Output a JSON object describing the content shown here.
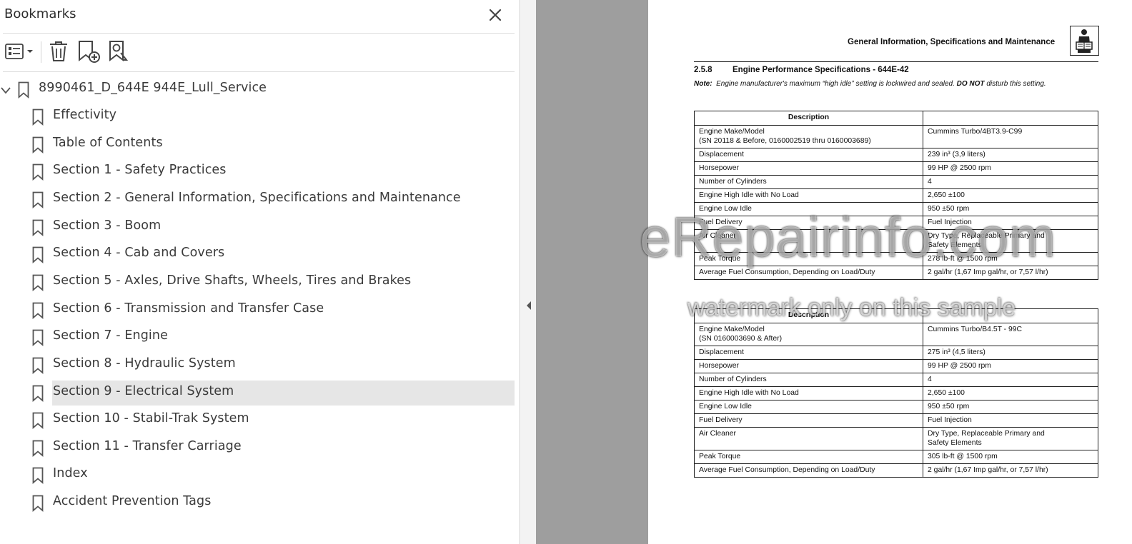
{
  "bookmarks_panel": {
    "title": "Bookmarks",
    "toolbar": {
      "options_button": "list-options-icon",
      "delete_button": "trash-icon",
      "new_bookmark_button": "bookmark-add-icon",
      "find_bookmark_button": "bookmark-search-icon"
    },
    "root": {
      "label": "8990461_D_644E 944E_Lull_Service",
      "expanded": true
    },
    "items": [
      {
        "label": "Effectivity"
      },
      {
        "label": "Table of Contents"
      },
      {
        "label": "Section 1 - Safety Practices"
      },
      {
        "label": "Section 2 - General Information, Specifications and Maintenance"
      },
      {
        "label": "Section 3 - Boom"
      },
      {
        "label": "Section 4 - Cab and Covers"
      },
      {
        "label": "Section 5 - Axles, Drive Shafts, Wheels, Tires and Brakes"
      },
      {
        "label": "Section 6 - Transmission and Transfer Case"
      },
      {
        "label": "Section 7 - Engine"
      },
      {
        "label": "Section 8 - Hydraulic System"
      },
      {
        "label": "Section 9 - Electrical System",
        "selected": true
      },
      {
        "label": "Section 10 - Stabil-Trak System"
      },
      {
        "label": "Section 11 - Transfer Carriage"
      },
      {
        "label": "Index"
      },
      {
        "label": "Accident Prevention Tags"
      }
    ]
  },
  "document": {
    "header": "General Information, Specifications and Maintenance",
    "section_number": "2.5.8",
    "section_title": "Engine Performance Specifications - 644E-42",
    "note_label": "Note:",
    "note_text_1": "Engine manufacturer's maximum “high idle” setting is lockwired and sealed.",
    "note_emph": "DO NOT",
    "note_text_2": "disturb this setting.",
    "table_1": {
      "header": [
        "Description",
        ""
      ],
      "rows": [
        [
          "Engine Make/Model\n(SN 20118 & Before, 0160002519 thru 0160003689)",
          "Cummins Turbo/4BT3.9-C99"
        ],
        [
          "Displacement",
          "239 in³ (3,9 liters)"
        ],
        [
          "Horsepower",
          "99 HP @ 2500 rpm"
        ],
        [
          "Number of Cylinders",
          "4"
        ],
        [
          "Engine High Idle with No Load",
          "2,650 ±100"
        ],
        [
          "Engine Low Idle",
          "950 ±50 rpm"
        ],
        [
          "Fuel Delivery",
          "Fuel Injection"
        ],
        [
          "Air Cleaner",
          "Dry Type, Replaceable Primary and\nSafety Elements"
        ],
        [
          "Peak Torque",
          "278 lb-ft @ 1500 rpm"
        ],
        [
          "Average Fuel Consumption, Depending on Load/Duty",
          "2 gal/hr (1,67 Imp gal/hr, or 7,57 l/hr)"
        ]
      ]
    },
    "table_2": {
      "header": [
        "Description",
        ""
      ],
      "rows": [
        [
          "Engine Make/Model\n(SN 0160003690 & After)",
          "Cummins Turbo/B4.5T - 99C"
        ],
        [
          "Displacement",
          "275 in³ (4,5 liters)"
        ],
        [
          "Horsepower",
          "99 HP @ 2500 rpm"
        ],
        [
          "Number of Cylinders",
          "4"
        ],
        [
          "Engine High Idle with No Load",
          "2,650 ±100"
        ],
        [
          "Engine Low Idle",
          "950 ±50 rpm"
        ],
        [
          "Fuel Delivery",
          "Fuel Injection"
        ],
        [
          "Air Cleaner",
          "Dry Type, Replaceable Primary and\nSafety Elements"
        ],
        [
          "Peak Torque",
          "305 lb-ft @ 1500 rpm"
        ],
        [
          "Average Fuel Consumption, Depending on Load/Duty",
          "2 gal/hr (1,67 Imp gal/hr, or 7,57 l/hr)"
        ]
      ]
    }
  },
  "watermark": {
    "main": "eRepairinfo.com",
    "sub": "watermark only on this sample"
  },
  "colors": {
    "panel_bg": "#ffffff",
    "selected_row": "#e6e6e6",
    "gutter_gray": "#9e9e9e",
    "text": "#3a3a3a"
  }
}
